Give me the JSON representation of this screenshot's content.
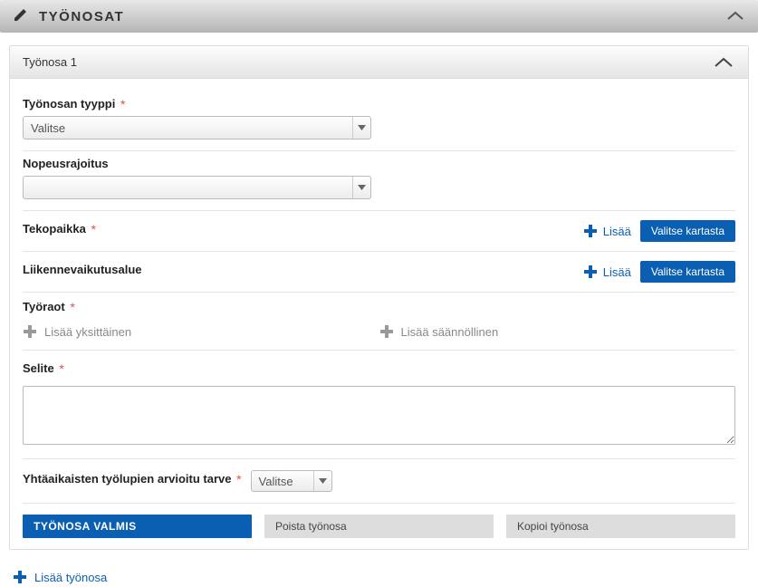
{
  "header": {
    "title": "TYÖNOSAT"
  },
  "panel": {
    "title": "Työnosa 1"
  },
  "fields": {
    "tyyppi": {
      "label": "Työnosan tyyppi",
      "selected": "Valitse"
    },
    "nopeus": {
      "label": "Nopeusrajoitus",
      "selected": ""
    },
    "tekopaikka": {
      "label": "Tekopaikka",
      "add": "Lisää",
      "map": "Valitse kartasta"
    },
    "liikenne": {
      "label": "Liikennevaikutusalue",
      "add": "Lisää",
      "map": "Valitse kartasta"
    },
    "tyoraot": {
      "label": "Työraot",
      "add_single": "Lisää yksittäinen",
      "add_recurring": "Lisää säännöllinen"
    },
    "selite": {
      "label": "Selite",
      "value": ""
    },
    "tarve": {
      "label": "Yhtäaikaisten työlupien arvioitu tarve",
      "selected": "Valitse"
    }
  },
  "buttons": {
    "ready": "TYÖNOSA VALMIS",
    "remove": "Poista työnosa",
    "copy": "Kopioi työnosa",
    "add_part": "Lisää työnosa"
  }
}
